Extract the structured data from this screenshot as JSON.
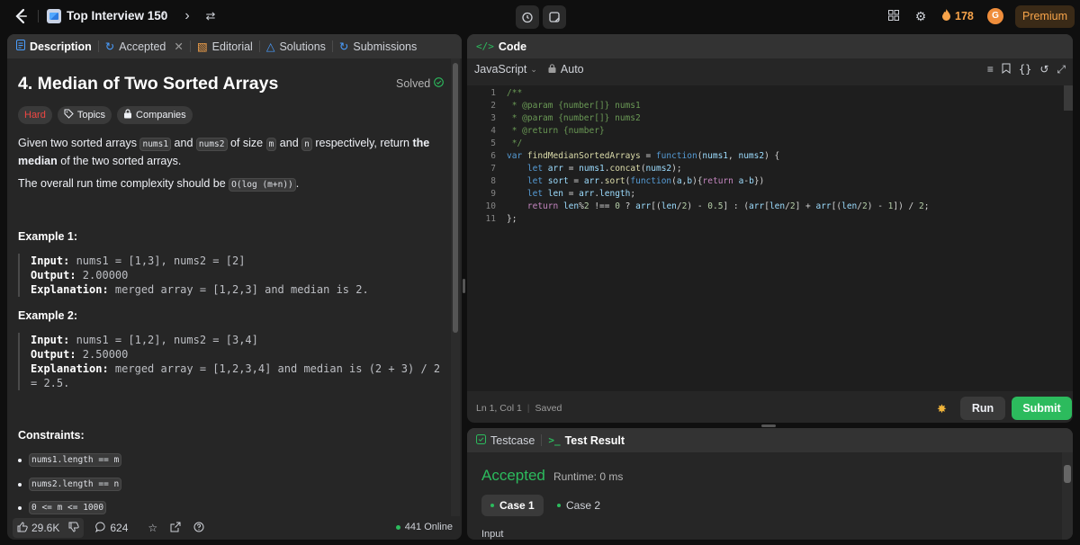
{
  "topbar": {
    "list_title": "Top Interview 150",
    "streak_count": "178",
    "avatar_initial": "G",
    "premium_label": "Premium"
  },
  "left_panel": {
    "tabs": [
      {
        "label": "Description"
      },
      {
        "label": "Accepted"
      },
      {
        "label": "Editorial"
      },
      {
        "label": "Solutions"
      },
      {
        "label": "Submissions"
      }
    ],
    "title": "4. Median of Two Sorted Arrays",
    "solved_label": "Solved",
    "chips": {
      "difficulty": "Hard",
      "topics": "Topics",
      "companies": "Companies"
    },
    "statement": {
      "p1_a": "Given two sorted arrays ",
      "p1_code1": "nums1",
      "p1_b": " and ",
      "p1_code2": "nums2",
      "p1_c": " of size ",
      "p1_code3": "m",
      "p1_d": " and ",
      "p1_code4": "n",
      "p1_e": " respectively, return ",
      "p1_bold": "the median",
      "p1_f": " of the two sorted arrays.",
      "p2_a": "The overall run time complexity should be ",
      "p2_code": "O(log (m+n))",
      "p2_b": "."
    },
    "examples": [
      {
        "heading": "Example 1:",
        "input_label": "Input:",
        "input": " nums1 = [1,3], nums2 = [2]",
        "output_label": "Output:",
        "output": " 2.00000",
        "explanation_label": "Explanation:",
        "explanation": " merged array = [1,2,3] and median is 2."
      },
      {
        "heading": "Example 2:",
        "input_label": "Input:",
        "input": " nums1 = [1,2], nums2 = [3,4]",
        "output_label": "Output:",
        "output": " 2.50000",
        "explanation_label": "Explanation:",
        "explanation": " merged array = [1,2,3,4] and median is (2 + 3) / 2 = 2.5."
      }
    ],
    "constraints_heading": "Constraints:",
    "constraints": [
      "nums1.length == m",
      "nums2.length == n",
      "0 <= m <= 1000"
    ],
    "footer": {
      "likes": "29.6K",
      "comments": "624",
      "online": "441 Online"
    }
  },
  "code_panel": {
    "tab_label": "Code",
    "language": "JavaScript",
    "mode": "Auto",
    "lines": [
      "1",
      "2",
      "3",
      "4",
      "5",
      "6",
      "7",
      "8",
      "9",
      "10",
      "11"
    ],
    "status_position": "Ln 1, Col 1",
    "status_saved": "Saved",
    "run_label": "Run",
    "submit_label": "Submit"
  },
  "result_panel": {
    "tab_testcase": "Testcase",
    "tab_result": "Test Result",
    "verdict": "Accepted",
    "runtime": "Runtime: 0 ms",
    "cases": [
      "Case 1",
      "Case 2"
    ],
    "input_label": "Input"
  }
}
